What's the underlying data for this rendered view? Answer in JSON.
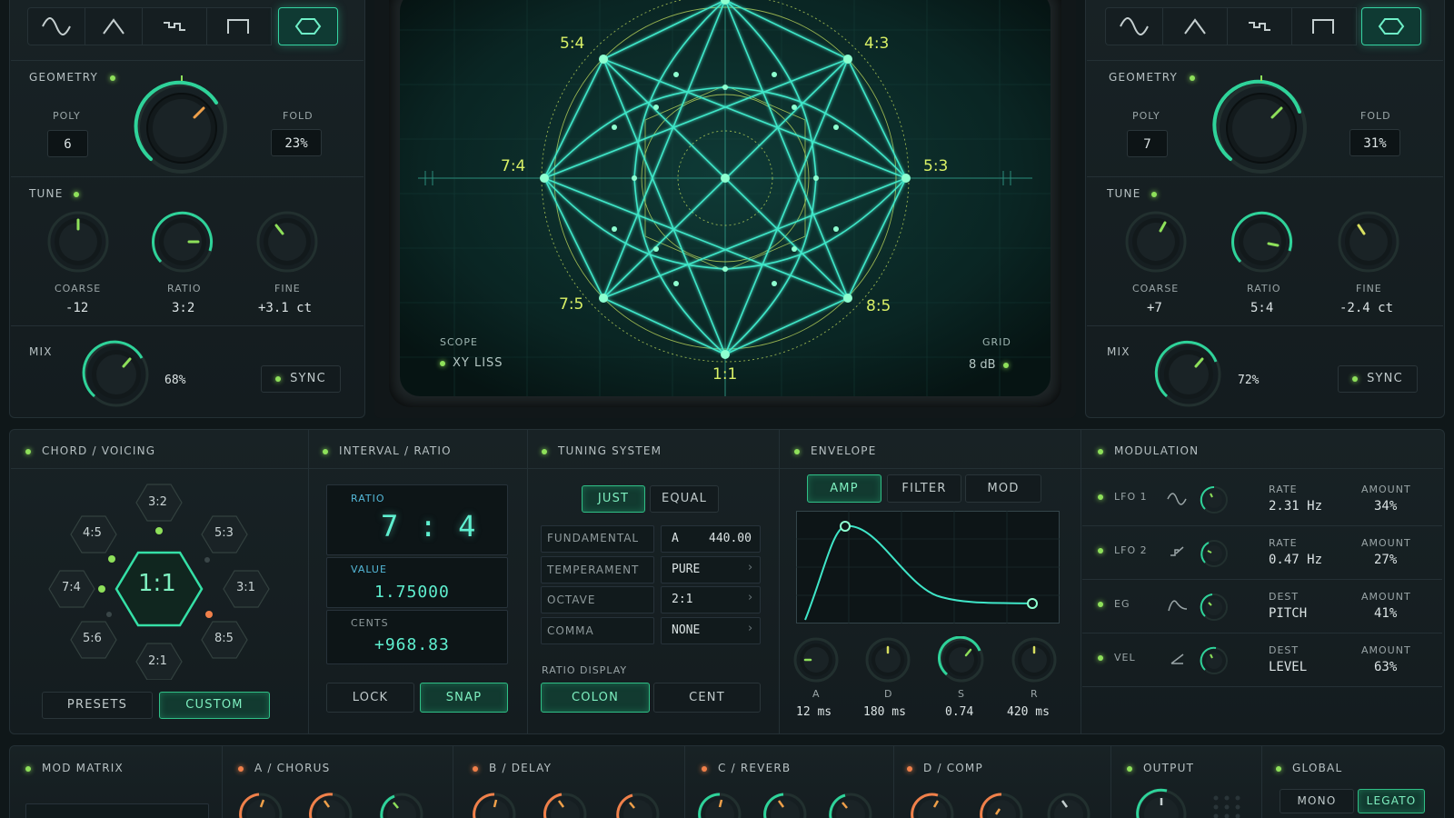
{
  "left_osc": {
    "wave_buttons": [
      "sine-icon",
      "triangle-icon",
      "step-icon",
      "square-icon",
      "hexagon-icon"
    ],
    "active_wave": 4,
    "geometry_label": "GEOMETRY",
    "poly_label": "POLY",
    "poly_value": "6",
    "fold_label": "FOLD",
    "fold_value": "23%",
    "tune_label": "TUNE",
    "coarse_label": "COARSE",
    "coarse_value": "-12",
    "ratio_label": "RATIO",
    "ratio_value": "3:2",
    "fine_label": "FINE",
    "fine_value": "+3.1 ct",
    "mix_label": "MIX",
    "mix_value": "68%",
    "sync_label": "SYNC"
  },
  "right_osc": {
    "geometry_label": "GEOMETRY",
    "poly_label": "POLY",
    "poly_value": "7",
    "fold_label": "FOLD",
    "fold_value": "31%",
    "tune_label": "TUNE",
    "coarse_label": "COARSE",
    "coarse_value": "+7",
    "ratio_label": "RATIO",
    "ratio_value": "5:4",
    "fine_label": "FINE",
    "fine_value": "-2.4 ct",
    "mix_label": "MIX",
    "mix_value": "72%",
    "sync_label": "SYNC"
  },
  "scope": {
    "ratio_labels": [
      "5:4",
      "4:3",
      "7:4",
      "5:3",
      "7:5",
      "8:5",
      "1:1"
    ],
    "scope_label": "SCOPE",
    "mode": "XY LISS",
    "grid_label": "GRID",
    "grid_value": "8 dB"
  },
  "chord": {
    "title": "CHORD / VOICING",
    "center": "1:1",
    "hexes": [
      "3:2",
      "4:5",
      "5:3",
      "7:4",
      "3:1",
      "5:6",
      "8:5",
      "2:1"
    ],
    "presets_label": "PRESETS",
    "custom_label": "CUSTOM"
  },
  "interval": {
    "title": "INTERVAL / RATIO",
    "ratio_label": "RATIO",
    "ratio_value": "7 : 4",
    "value_label": "VALUE",
    "value": "1.75000",
    "cents_label": "CENTS",
    "cents": "+968.83",
    "lock_label": "LOCK",
    "snap_label": "SNAP"
  },
  "tuning": {
    "title": "TUNING SYSTEM",
    "just_label": "JUST",
    "equal_label": "EQUAL",
    "rows": [
      {
        "label": "FUNDAMENTAL",
        "note": "A",
        "value": "440.00"
      },
      {
        "label": "TEMPERAMENT",
        "value": "PURE"
      },
      {
        "label": "OCTAVE",
        "value": "2:1"
      },
      {
        "label": "COMMA",
        "value": "NONE"
      }
    ],
    "ratio_display_label": "RATIO DISPLAY",
    "colon_label": "COLON",
    "cent_label": "CENT"
  },
  "envelope": {
    "title": "ENVELOPE",
    "tabs": [
      "AMP",
      "FILTER",
      "MOD"
    ],
    "knobs": [
      {
        "label": "A",
        "value": "12 ms"
      },
      {
        "label": "D",
        "value": "180 ms"
      },
      {
        "label": "S",
        "value": "0.74"
      },
      {
        "label": "R",
        "value": "420 ms"
      }
    ]
  },
  "modulation": {
    "title": "MODULATION",
    "rows": [
      {
        "name": "LFO 1",
        "icon": "sine-icon",
        "k1": "RATE",
        "v1": "2.31 Hz",
        "k2": "AMOUNT",
        "v2": "34%"
      },
      {
        "name": "LFO 2",
        "icon": "step-icon",
        "k1": "RATE",
        "v1": "0.47 Hz",
        "k2": "AMOUNT",
        "v2": "27%"
      },
      {
        "name": "EG",
        "icon": "envelope-icon",
        "k1": "DEST",
        "v1": "PITCH",
        "k2": "AMOUNT",
        "v2": "41%"
      },
      {
        "name": "VEL",
        "icon": "velocity-icon",
        "k1": "DEST",
        "v1": "LEVEL",
        "k2": "AMOUNT",
        "v2": "63%"
      }
    ]
  },
  "bottom": {
    "mod_matrix": "MOD MATRIX",
    "chorus": "A / CHORUS",
    "delay": "B / DELAY",
    "reverb": "C / REVERB",
    "comp": "D / COMP",
    "output": "OUTPUT",
    "global": "GLOBAL",
    "mono_label": "MONO",
    "legato_label": "LEGATO"
  },
  "colors": {
    "accent": "#35d3a2",
    "led_green": "#8ee05a",
    "led_orange": "#f0804a",
    "scope_trace": "#3fe6c8",
    "scope_yellow": "#b9d45a"
  }
}
